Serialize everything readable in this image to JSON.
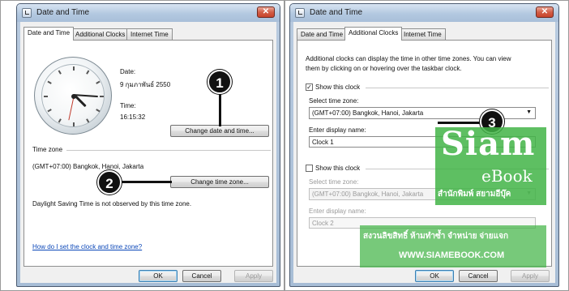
{
  "left_dialog": {
    "title": "Date and Time",
    "close_glyph": "✕",
    "tabs": [
      "Date and Time",
      "Additional Clocks",
      "Internet Time"
    ],
    "date_label": "Date:",
    "date_value": "9 กุมภาพันธ์ 2550",
    "time_label": "Time:",
    "time_value": "16:15:32",
    "change_datetime_button": "Change date and time...",
    "timezone_heading": "Time zone",
    "timezone_value": "(GMT+07:00) Bangkok, Hanoi, Jakarta",
    "change_timezone_button": "Change time zone...",
    "dst_note": "Daylight Saving Time is not observed by this time zone.",
    "help_link": "How do I set the clock and time zone?",
    "ok_button": "OK",
    "cancel_button": "Cancel",
    "apply_button": "Apply"
  },
  "right_dialog": {
    "title": "Date and Time",
    "close_glyph": "✕",
    "tabs": [
      "Date and Time",
      "Additional Clocks",
      "Internet Time"
    ],
    "intro_line1": "Additional clocks can display the time in other time zones. You can view",
    "intro_line2": "them by clicking on or hovering over the taskbar clock.",
    "clock1": {
      "checked_glyph": "✓",
      "show_label": "Show this clock",
      "select_label": "Select time zone:",
      "timezone_value": "(GMT+07:00) Bangkok, Hanoi, Jakarta",
      "name_label": "Enter display name:",
      "name_value": "Clock 1"
    },
    "clock2": {
      "show_label": "Show this clock",
      "select_label": "Select time zone:",
      "timezone_value": "(GMT+07:00) Bangkok, Hanoi, Jakarta",
      "name_label": "Enter display name:",
      "name_value": "Clock 2"
    },
    "dropdown_arrow": "▼",
    "ok_button": "OK",
    "cancel_button": "Cancel",
    "apply_button": "Apply"
  },
  "callouts": [
    "1",
    "2",
    "3"
  ],
  "watermark": {
    "brand": "Siam",
    "sub": "eBook",
    "thai_tagline": "สำนักพิมพ์ สยามอีบุ๊ค",
    "copyright": "สงวนลิขสิทธิ์ ห้ามทำซ้ำ จำหน่าย จ่ายแจก",
    "url": "WWW.SIAMEBOOK.COM"
  },
  "colors": {
    "link": "#0b47b8",
    "close_button": "#c7432b",
    "watermark_green": "#42b446"
  }
}
